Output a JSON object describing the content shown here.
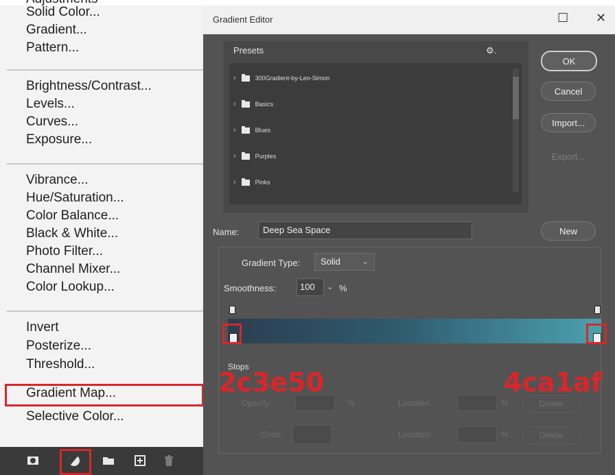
{
  "menu": {
    "partial_top_item": "Adjustments",
    "groups": [
      [
        "Solid Color...",
        "Gradient...",
        "Pattern..."
      ],
      [
        "Brightness/Contrast...",
        "Levels...",
        "Curves...",
        "Exposure..."
      ],
      [
        "Vibrance...",
        "Hue/Saturation...",
        "Color Balance...",
        "Black & White...",
        "Photo Filter...",
        "Channel Mixer...",
        "Color Lookup..."
      ],
      [
        "Invert",
        "Posterize...",
        "Threshold...",
        "Gradient Map...",
        "Selective Color..."
      ]
    ],
    "highlighted_item": "Gradient Map...",
    "bottom_icons": [
      "mask-icon",
      "adjustment-layer-icon",
      "folder-icon",
      "new-layer-icon",
      "trash-icon"
    ]
  },
  "dialog": {
    "title": "Gradient Editor",
    "presets_label": "Presets",
    "preset_folders": [
      "300Gradient-by-Leo-Simon",
      "Basics",
      "Blues",
      "Purples",
      "Pinks"
    ],
    "buttons": {
      "ok": "OK",
      "cancel": "Cancel",
      "import": "Import...",
      "export": "Export...",
      "new": "New"
    },
    "name_label": "Name:",
    "name_value": "Deep Sea Space",
    "gradient_type_label": "Gradient Type:",
    "gradient_type_value": "Solid",
    "smoothness_label": "Smoothness:",
    "smoothness_value": "100",
    "smoothness_unit": "%",
    "stops_label": "Stops",
    "opacity_label": "Opacity:",
    "color_label": "Color:",
    "location_label": "Location:",
    "percent": "%",
    "delete_label": "Delete",
    "gradient": {
      "start_color": "#2c3e50",
      "end_color": "#4ca1af"
    }
  },
  "annotations": {
    "left_stop": "2c3e50",
    "right_stop": "4ca1af"
  }
}
